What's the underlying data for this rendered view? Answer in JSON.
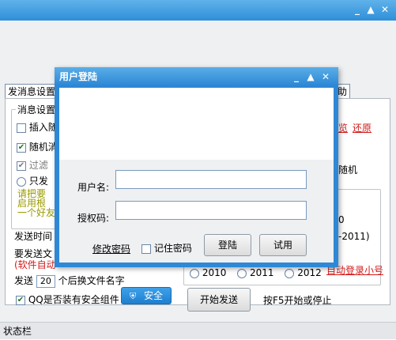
{
  "main": {
    "tabs": [
      "发消息设置",
      "助"
    ],
    "group_title": "消息设置",
    "checks": [
      {
        "label": "插入随",
        "checked": false
      },
      {
        "label": "随机消",
        "checked": true
      },
      {
        "label": "过滤",
        "checked": true
      },
      {
        "label": "只发",
        "radio": true
      }
    ],
    "olive_lines": [
      "请把要",
      "启用根",
      "一个好友"
    ],
    "left_texts": [
      "发送时间",
      "要发送文",
      "(软件自动"
    ],
    "send_prefix": "发送",
    "send_count": "20",
    "send_suffix": "个后换文件名字",
    "security_check_label": "QQ是否装有安全组件",
    "security_button": "安全",
    "right_links": [
      "览",
      "还原"
    ],
    "right_text": "随机",
    "right_frag1": "0",
    "right_frag2": "-2011)",
    "years": [
      "2010",
      "2011",
      "2012"
    ],
    "auto_login_link": "自动登录小号",
    "start_button": "开始发送",
    "hint": "按F5开始或停止",
    "status_label": "状态栏"
  },
  "dialog": {
    "title": "用户登陆",
    "username_label": "用户名:",
    "password_label": "授权码:",
    "username_value": "",
    "password_value": "",
    "change_password_link": "修改密码",
    "remember_label": "记住密码",
    "login_button": "登陆",
    "trial_button": "试用"
  },
  "colors": {
    "title_blue": "#2f8fd8",
    "link_red": "#d21a1a",
    "olive": "#9a9a00"
  }
}
